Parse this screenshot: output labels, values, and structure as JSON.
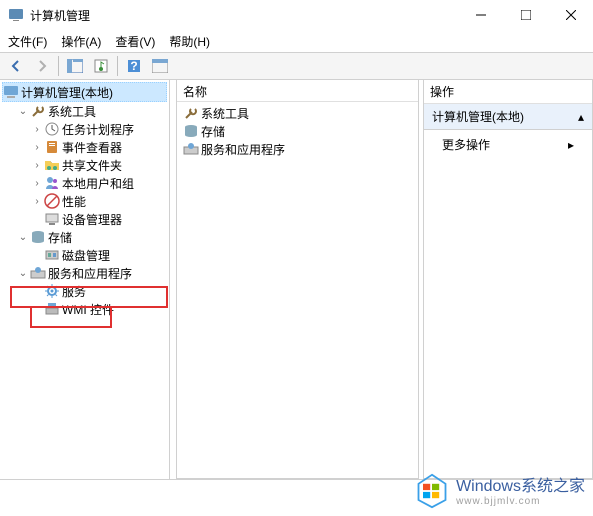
{
  "title": "计算机管理",
  "menu": {
    "file": "文件(F)",
    "action": "操作(A)",
    "view": "查看(V)",
    "help": "帮助(H)"
  },
  "tree": {
    "root": "计算机管理(本地)",
    "g1": "系统工具",
    "g1_items": [
      "任务计划程序",
      "事件查看器",
      "共享文件夹",
      "本地用户和组",
      "性能",
      "设备管理器"
    ],
    "g2": "存储",
    "g2_items": [
      "磁盘管理"
    ],
    "g3": "服务和应用程序",
    "g3_items": [
      "服务",
      "WMI 控件"
    ]
  },
  "mid": {
    "header": "名称",
    "items": [
      "系统工具",
      "存储",
      "服务和应用程序"
    ]
  },
  "actions": {
    "header": "操作",
    "section": "计算机管理(本地)",
    "more": "更多操作"
  },
  "footer": {
    "main": "Windows系统之家",
    "sub": "www.bjjmlv.com"
  }
}
